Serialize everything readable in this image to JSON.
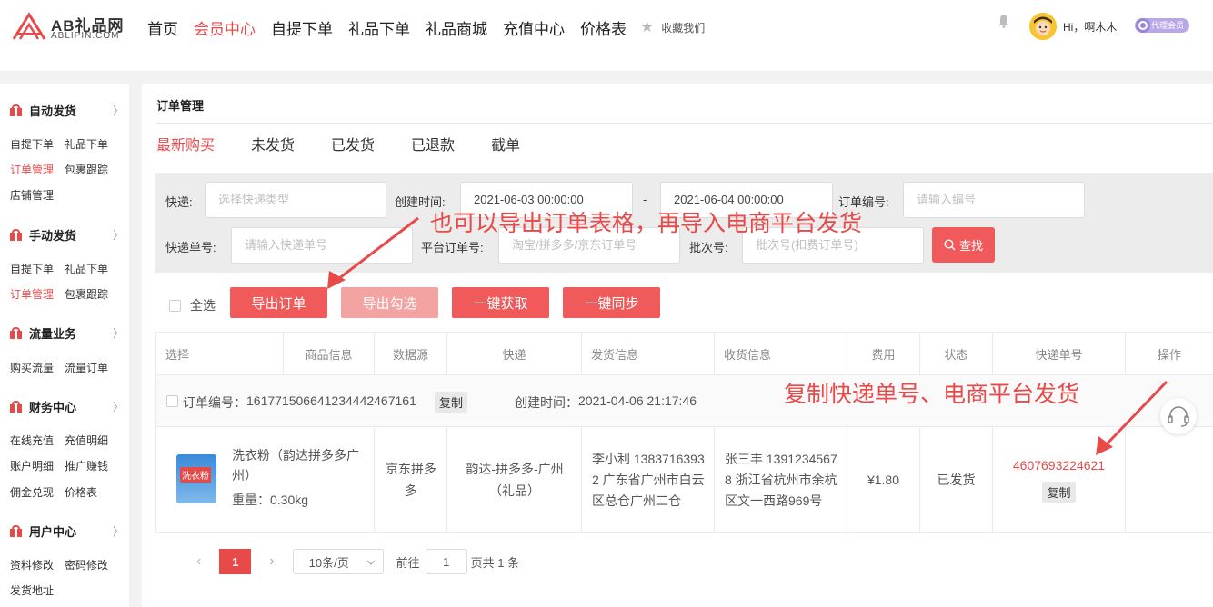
{
  "header": {
    "logo_main": "AB礼品网",
    "logo_sub": "ABLIPIN.COM",
    "nav": [
      "首页",
      "会员中心",
      "自提下单",
      "礼品下单",
      "礼品商城",
      "充值中心",
      "价格表"
    ],
    "nav_active_index": 1,
    "favorite_label": "收藏我们",
    "greeting": "Hi，啊木木",
    "vip_badge": "代理会员"
  },
  "sidebar": {
    "sections": [
      {
        "title": "自动发货",
        "links": [
          "自提下单",
          "礼品下单",
          "订单管理",
          "包裹跟踪",
          "店铺管理"
        ]
      },
      {
        "title": "手动发货",
        "links": [
          "自提下单",
          "礼品下单",
          "订单管理",
          "包裹跟踪"
        ]
      },
      {
        "title": "流量业务",
        "links": [
          "购买流量",
          "流量订单"
        ]
      },
      {
        "title": "财务中心",
        "links": [
          "在线充值",
          "充值明细",
          "账户明细",
          "推广赚钱",
          "佣金兑现",
          "价格表"
        ]
      },
      {
        "title": "用户中心",
        "links": [
          "资料修改",
          "密码修改",
          "发货地址"
        ]
      }
    ]
  },
  "main": {
    "title": "订单管理",
    "tabs": [
      "最新购买",
      "未发货",
      "已发货",
      "已退款",
      "截单"
    ],
    "filters": {
      "express_label": "快递:",
      "express_placeholder": "选择快递类型",
      "created_label": "创建时间:",
      "date_from": "2021-06-03 00:00:00",
      "date_sep": "-",
      "date_to": "2021-06-04 00:00:00",
      "order_no_label": "订单编号:",
      "order_no_placeholder": "请输入编号",
      "tracking_label": "快递单号:",
      "tracking_placeholder": "请输入快递单号",
      "platform_label": "平台订单号:",
      "platform_placeholder": "淘宝/拼多多/京东订单号",
      "batch_label": "批次号:",
      "batch_placeholder": "批次号(扣费订单号)",
      "search_button": "查找"
    },
    "select_all": "全选",
    "actions": [
      "导出订单",
      "导出勾选",
      "一键获取",
      "一键同步"
    ],
    "table": {
      "columns": [
        "选择",
        "商品信息",
        "数据源",
        "快递",
        "发货信息",
        "收货信息",
        "费用",
        "状态",
        "快递单号",
        "操作"
      ],
      "order": {
        "order_no_label": "订单编号：",
        "order_no": "16177150664123444246​7161",
        "copy": "复制",
        "created_label": "创建时间：",
        "created": "2021-04-06 21:17:46"
      },
      "row": {
        "product_image_text": "洗衣粉",
        "product_name": "洗衣粉（韵达拼多多广州）",
        "weight": "重量：0.30kg",
        "source": "京东拼多多",
        "express": "韵达-拼多多-广州（礼品）",
        "sender": "李小利 13837163932 广东省广州市白云区总仓广州二仓",
        "receiver": "张三丰 13912345678 浙江省杭州市余杭区文一西路969号",
        "fee": "¥1.80",
        "status": "已发货",
        "tracking_no": "4607693224621",
        "tracking_copy": "复制"
      }
    },
    "pagination": {
      "prev": "‹",
      "current": "1",
      "next": "›",
      "page_size": "10条/页",
      "goto_prefix": "前往",
      "goto_value": "1",
      "total_text": "页共 1 条"
    }
  },
  "annotations": {
    "top": "也可以导出订单表格，再导入电商平台发货",
    "right": "复制快递单号、电商平台发货"
  },
  "colors": {
    "accent": "#e84a4a",
    "button": "#f05a5a",
    "button_disabled": "#f4a3a3"
  }
}
